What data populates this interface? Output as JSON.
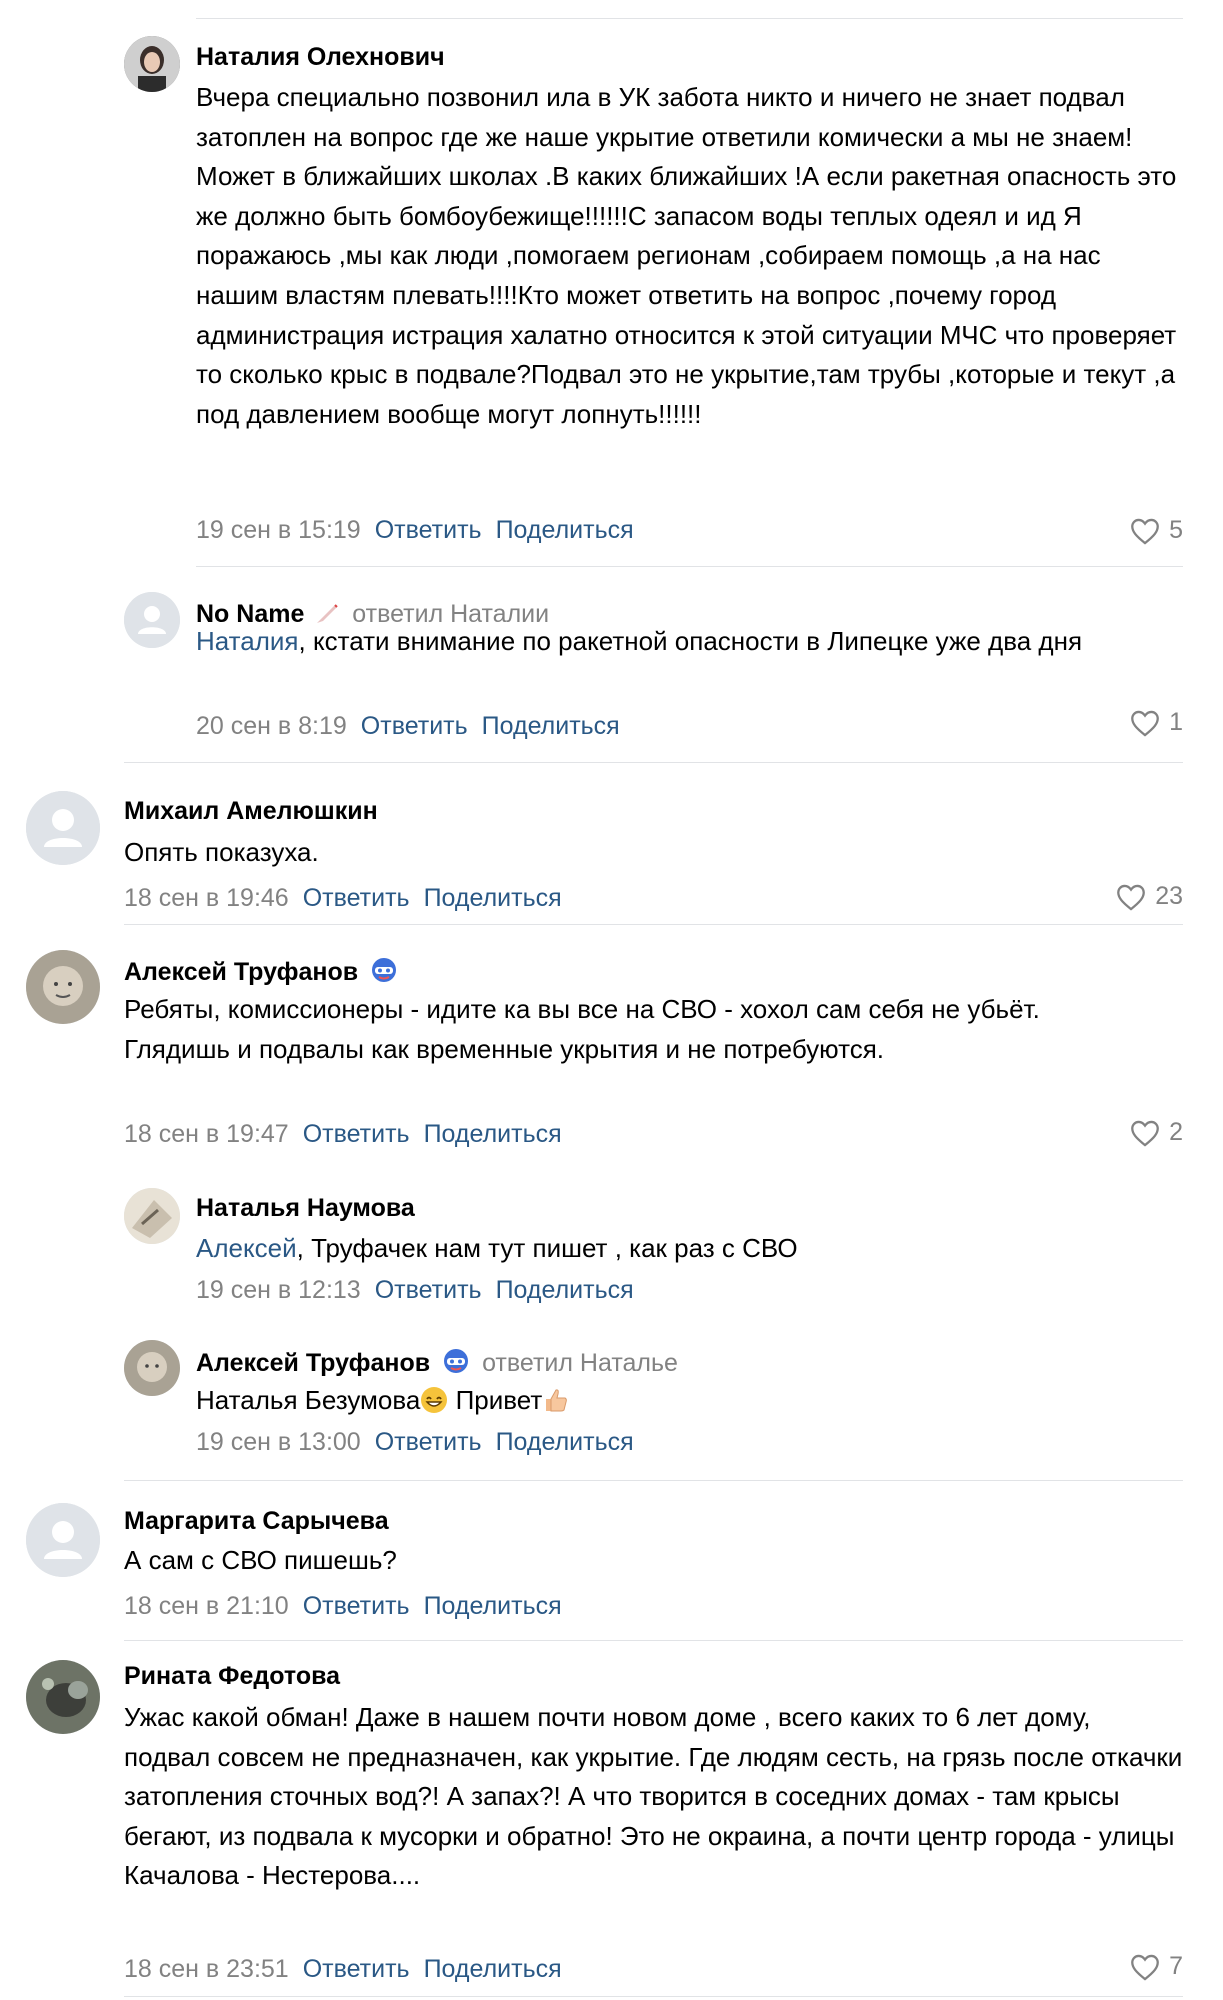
{
  "actions": {
    "reply": "Ответить",
    "share": "Поделиться"
  },
  "comments": [
    {
      "author": "Наталия Олехнович",
      "text": "Вчера специально позвонил ила в УК забота никто и ничего не знает подвал затоплен на вопрос где же наше укрытие ответили комически а мы не знаем!Может в ближайших школах .В каких ближайших !А если ракетная опасность это же должно быть бомбоубежище!!!!!!С запасом воды теплых одеял и ид Я поражаюсь ,мы как люди ,помогаем регионам ,собираем помощь ,а на нас нашим властям плевать!!!!Кто может ответить на вопрос ,почему город администрация истрация халатно относится к этой ситуации МЧС что проверяет то сколько крыс в подвале?Подвал это не укрытие,там трубы ,которые и текут ,а под давлением вообще могут лопнуть!!!!!!",
      "date": "19 сен в 15:19",
      "likes": "5"
    },
    {
      "author": "No Name",
      "replied_to": "ответил Наталии",
      "mention": "Наталия",
      "text": ", кстати внимание по ракетной опасности в Липецке уже два дня",
      "date": "20 сен в 8:19",
      "likes": "1"
    },
    {
      "author": "Михаил Амелюшкин",
      "text": "Опять показуха.",
      "date": "18 сен в 19:46",
      "likes": "23"
    },
    {
      "author": "Алексей Труфанов",
      "text": "Ребяты, комиссионеры - идите ка вы все на СВО - хохол сам себя не убьёт.",
      "text2": "Глядишь и подвалы как временные укрытия и не потребуются.",
      "date": "18 сен в 19:47",
      "likes": "2"
    },
    {
      "author": "Наталья Наумова",
      "mention": "Алексей",
      "text": ", Труфачек нам тут пишет , как раз с СВО",
      "date": "19 сен в 12:13"
    },
    {
      "author": "Алексей Труфанов",
      "replied_to": "ответил Наталье",
      "text_a": "Наталья Безумова",
      "text_b": " Привет",
      "date": "19 сен в 13:00"
    },
    {
      "author": "Маргарита Сарычева",
      "text": "А сам с СВО пишешь?",
      "date": "18 сен в 21:10"
    },
    {
      "author": "Рината Федотова",
      "text": "Ужас какой обман! Даже в нашем почти новом доме , всего каких то 6 лет дому, подвал совсем не предназначен, как укрытие. Где людям сесть, на грязь после откачки затопления сточных вод?! А запах?! А что творится в соседних домах - там крысы бегают, из подвала к мусорки и обратно! Это не окраина, а почти центр города - улицы Качалова - Нестерова....",
      "date": "18 сен в 23:51",
      "likes": "7"
    }
  ],
  "colors": {
    "link": "#2a5885",
    "muted": "#828282",
    "separator": "#e1e3e6"
  }
}
